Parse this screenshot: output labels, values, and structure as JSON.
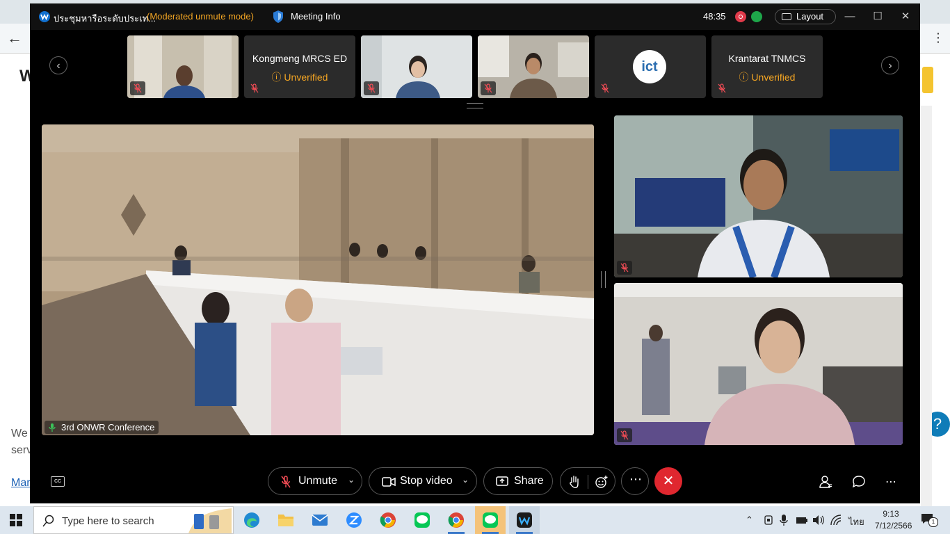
{
  "window": {
    "title": "ประชุมหารือระดับประเท...",
    "mode": "(Moderated unmute mode)",
    "meeting_info": "Meeting Info",
    "timer": "48:35",
    "layout_label": "Layout"
  },
  "thumbnails": [
    {
      "name": "",
      "status": "",
      "kind": "video"
    },
    {
      "name": "Kongmeng MRCS ED",
      "status": "Unverified",
      "kind": "name"
    },
    {
      "name": "",
      "status": "",
      "kind": "video"
    },
    {
      "name": "",
      "status": "",
      "kind": "video"
    },
    {
      "name": "",
      "status": "",
      "kind": "logo",
      "logo_text": "ict"
    },
    {
      "name": "Krantarat TNMCS",
      "status": "Unverified",
      "kind": "name"
    }
  ],
  "stage": {
    "main_label": "3rd ONWR Conference"
  },
  "controls": {
    "unmute": "Unmute",
    "stop_video": "Stop video",
    "share": "Share"
  },
  "taskbar": {
    "search_placeholder": "Type here to search",
    "time": "9:13",
    "date": "7/12/2566",
    "language": "ไทย",
    "notifications": "1"
  },
  "background": {
    "heading_letter": "W",
    "body_text": "We serv",
    "link_text": "Mar",
    "help": "?"
  },
  "colors": {
    "accent_orange": "#f5a623",
    "end_red": "#e0272f",
    "record_red": "#e03a4a",
    "stats_green": "#1ea64a"
  }
}
